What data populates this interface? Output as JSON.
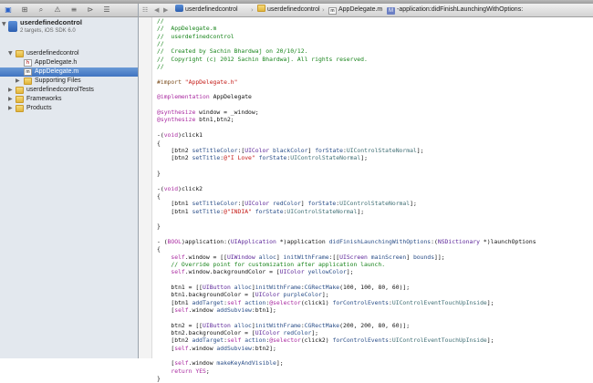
{
  "navigator": {
    "project": {
      "name": "userdefinedcontrol",
      "subtitle": "2 targets, iOS SDK 6.0"
    },
    "items": [
      {
        "label": "userdefinedcontrol",
        "kind": "folder",
        "expanded": true
      },
      {
        "label": "AppDelegate.h",
        "kind": "h-file"
      },
      {
        "label": "AppDelegate.m",
        "kind": "m-file",
        "selected": true
      },
      {
        "label": "Supporting Files",
        "kind": "folder",
        "expanded": false
      },
      {
        "label": "userdefinedcontrolTests",
        "kind": "folder",
        "expanded": false
      },
      {
        "label": "Frameworks",
        "kind": "folder",
        "expanded": false
      },
      {
        "label": "Products",
        "kind": "folder",
        "expanded": false
      }
    ]
  },
  "jumpbar": {
    "crumbs": [
      "userdefinedcontrol",
      "userdefinedcontrol",
      "AppDelegate.m",
      "-application:didFinishLaunchingWithOptions:"
    ]
  },
  "code": {
    "lines": [
      [
        [
          "//",
          "cm"
        ]
      ],
      [
        [
          "//  AppDelegate.m",
          "cm"
        ]
      ],
      [
        [
          "//  userdefinedcontrol",
          "cm"
        ]
      ],
      [
        [
          "//",
          "cm"
        ]
      ],
      [
        [
          "//  Created by Sachin Bhardwaj on 20/10/12.",
          "cm"
        ]
      ],
      [
        [
          "//  Copyright (c) 2012 Sachin Bhardwaj. All rights reserved.",
          "cm"
        ]
      ],
      [
        [
          "//",
          "cm"
        ]
      ],
      [],
      [
        [
          "#import ",
          "pp"
        ],
        [
          "\"AppDelegate.h\"",
          "str"
        ]
      ],
      [],
      [
        [
          "@implementation",
          "kw"
        ],
        [
          " AppDelegate",
          ""
        ]
      ],
      [],
      [
        [
          "@synthesize",
          "kw"
        ],
        [
          " window = _window;",
          ""
        ]
      ],
      [
        [
          "@synthesize",
          "kw"
        ],
        [
          " btn1,btn2;",
          ""
        ]
      ],
      [],
      [
        [
          "-(",
          ""
        ],
        [
          "void",
          "kw"
        ],
        [
          ")click1",
          ""
        ]
      ],
      [
        [
          "{",
          ""
        ]
      ],
      [
        [
          "    [btn2 ",
          ""
        ],
        [
          "setTitleColor",
          "me"
        ],
        [
          ":[",
          ""
        ],
        [
          "UIColor",
          "ty"
        ],
        [
          " ",
          ""
        ],
        [
          "blackColor",
          "me"
        ],
        [
          "] ",
          ""
        ],
        [
          "forState",
          "me"
        ],
        [
          ":",
          ""
        ],
        [
          "UIControlStateNormal",
          "iv"
        ],
        [
          "];",
          ""
        ]
      ],
      [
        [
          "    [btn2 ",
          ""
        ],
        [
          "setTitle",
          "me"
        ],
        [
          ":",
          ""
        ],
        [
          "@\"I Love\"",
          "str"
        ],
        [
          " ",
          ""
        ],
        [
          "forState",
          "me"
        ],
        [
          ":",
          ""
        ],
        [
          "UIControlStateNormal",
          "iv"
        ],
        [
          "];",
          ""
        ]
      ],
      [],
      [
        [
          "}",
          ""
        ]
      ],
      [],
      [
        [
          "-(",
          ""
        ],
        [
          "void",
          "kw"
        ],
        [
          ")click2",
          ""
        ]
      ],
      [
        [
          "{",
          ""
        ]
      ],
      [
        [
          "    [btn1 ",
          ""
        ],
        [
          "setTitleColor",
          "me"
        ],
        [
          ":[",
          ""
        ],
        [
          "UIColor",
          "ty"
        ],
        [
          " ",
          ""
        ],
        [
          "redColor",
          "me"
        ],
        [
          "] ",
          ""
        ],
        [
          "forState",
          "me"
        ],
        [
          ":",
          ""
        ],
        [
          "UIControlStateNormal",
          "iv"
        ],
        [
          "];",
          ""
        ]
      ],
      [
        [
          "    [btn1 ",
          ""
        ],
        [
          "setTitle",
          "me"
        ],
        [
          ":",
          ""
        ],
        [
          "@\"INDIA\"",
          "str"
        ],
        [
          " ",
          ""
        ],
        [
          "forState",
          "me"
        ],
        [
          ":",
          ""
        ],
        [
          "UIControlStateNormal",
          "iv"
        ],
        [
          "];",
          ""
        ]
      ],
      [],
      [
        [
          "}",
          ""
        ]
      ],
      [],
      [
        [
          "- (",
          ""
        ],
        [
          "BOOL",
          "kw"
        ],
        [
          ")application:(",
          ""
        ],
        [
          "UIApplication",
          "ty"
        ],
        [
          " *)application ",
          ""
        ],
        [
          "didFinishLaunchingWithOptions",
          "me"
        ],
        [
          ":(",
          ""
        ],
        [
          "NSDictionary",
          "ty"
        ],
        [
          " *)launchOptions",
          ""
        ]
      ],
      [
        [
          "{",
          ""
        ]
      ],
      [
        [
          "    ",
          ""
        ],
        [
          "self",
          "kw"
        ],
        [
          ".window = [[",
          ""
        ],
        [
          "UIWindow",
          "ty"
        ],
        [
          " ",
          ""
        ],
        [
          "alloc",
          "me"
        ],
        [
          "] ",
          ""
        ],
        [
          "initWithFrame",
          "me"
        ],
        [
          ":[[",
          ""
        ],
        [
          "UIScreen",
          "ty"
        ],
        [
          " ",
          ""
        ],
        [
          "mainScreen",
          "me"
        ],
        [
          "] ",
          ""
        ],
        [
          "bounds",
          "me"
        ],
        [
          "]];",
          ""
        ]
      ],
      [
        [
          "    // Override point for customization after application launch.",
          "cm"
        ]
      ],
      [
        [
          "    ",
          ""
        ],
        [
          "self",
          "kw"
        ],
        [
          ".window.backgroundColor = [",
          ""
        ],
        [
          "UIColor",
          "ty"
        ],
        [
          " ",
          ""
        ],
        [
          "yellowColor",
          "me"
        ],
        [
          "];",
          ""
        ]
      ],
      [],
      [
        [
          "    btn1 = [[",
          ""
        ],
        [
          "UIButton",
          "ty"
        ],
        [
          " ",
          ""
        ],
        [
          "alloc",
          "me"
        ],
        [
          "]",
          ""
        ],
        [
          "initWithFrame",
          "me"
        ],
        [
          ":",
          ""
        ],
        [
          "CGRectMake",
          "me"
        ],
        [
          "(100, 100, 80, 60)];",
          ""
        ]
      ],
      [
        [
          "    btn1.backgroundColor = [",
          ""
        ],
        [
          "UIColor",
          "ty"
        ],
        [
          " ",
          ""
        ],
        [
          "purpleColor",
          "me"
        ],
        [
          "];",
          ""
        ]
      ],
      [
        [
          "    [btn1 ",
          ""
        ],
        [
          "addTarget",
          "me"
        ],
        [
          ":",
          ""
        ],
        [
          "self",
          "kw"
        ],
        [
          " ",
          ""
        ],
        [
          "action",
          "me"
        ],
        [
          ":",
          ""
        ],
        [
          "@selector",
          "kw"
        ],
        [
          "(click1) ",
          ""
        ],
        [
          "forControlEvents",
          "me"
        ],
        [
          ":",
          ""
        ],
        [
          "UIControlEventTouchUpInside",
          "iv"
        ],
        [
          "];",
          ""
        ]
      ],
      [
        [
          "    [",
          ""
        ],
        [
          "self",
          "kw"
        ],
        [
          ".window ",
          ""
        ],
        [
          "addSubview",
          "me"
        ],
        [
          ":btn1];",
          ""
        ]
      ],
      [],
      [
        [
          "    btn2 = [[",
          ""
        ],
        [
          "UIButton",
          "ty"
        ],
        [
          " ",
          ""
        ],
        [
          "alloc",
          "me"
        ],
        [
          "]",
          ""
        ],
        [
          "initWithFrame",
          "me"
        ],
        [
          ":",
          ""
        ],
        [
          "CGRectMake",
          "me"
        ],
        [
          "(200, 200, 80, 60)];",
          ""
        ]
      ],
      [
        [
          "    btn2.backgroundColor = [",
          ""
        ],
        [
          "UIColor",
          "ty"
        ],
        [
          " ",
          ""
        ],
        [
          "redColor",
          "me"
        ],
        [
          "];",
          ""
        ]
      ],
      [
        [
          "    [btn2 ",
          ""
        ],
        [
          "addTarget",
          "me"
        ],
        [
          ":",
          ""
        ],
        [
          "self",
          "kw"
        ],
        [
          " ",
          ""
        ],
        [
          "action",
          "me"
        ],
        [
          ":",
          ""
        ],
        [
          "@selector",
          "kw"
        ],
        [
          "(click2) ",
          ""
        ],
        [
          "forControlEvents",
          "me"
        ],
        [
          ":",
          ""
        ],
        [
          "UIControlEventTouchUpInside",
          "iv"
        ],
        [
          "];",
          ""
        ]
      ],
      [
        [
          "    [",
          ""
        ],
        [
          "self",
          "kw"
        ],
        [
          ".window ",
          ""
        ],
        [
          "addSubview",
          "me"
        ],
        [
          ":btn2];",
          ""
        ]
      ],
      [],
      [
        [
          "    [",
          ""
        ],
        [
          "self",
          "kw"
        ],
        [
          ".window ",
          ""
        ],
        [
          "makeKeyAndVisible",
          "me"
        ],
        [
          "];",
          ""
        ]
      ],
      [
        [
          "    ",
          ""
        ],
        [
          "return",
          "kw"
        ],
        [
          " ",
          ""
        ],
        [
          "YES",
          "kw"
        ],
        [
          ";",
          ""
        ]
      ],
      [
        [
          "}",
          ""
        ]
      ]
    ]
  }
}
